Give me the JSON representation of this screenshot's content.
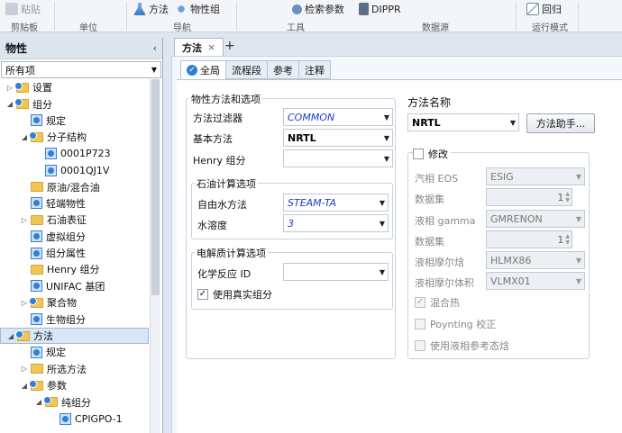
{
  "ribbon": {
    "paste": "粘贴",
    "clipboard": "剪贴板",
    "unit": "单位",
    "method": "方法",
    "property_set": "物性组",
    "nav": "导航",
    "retrieve_params": "检索参数",
    "tools": "工具",
    "dippr": "DIPPR",
    "datasource": "数据源",
    "revert": "回归",
    "run_mode": "运行模式"
  },
  "left": {
    "title": "物性",
    "collapse": "‹",
    "filter_value": "所有项",
    "tree": [
      {
        "label": "设置",
        "level": 0,
        "toggle": "▷",
        "icon": "folder-check"
      },
      {
        "label": "组分",
        "level": 0,
        "toggle": "◢",
        "icon": "folder-check"
      },
      {
        "label": "规定",
        "level": 1,
        "toggle": "",
        "icon": "form-check"
      },
      {
        "label": "分子结构",
        "level": 1,
        "toggle": "◢",
        "icon": "folder-check"
      },
      {
        "label": "0001P723",
        "level": 2,
        "toggle": "",
        "icon": "form-check"
      },
      {
        "label": "0001QJ1V",
        "level": 2,
        "toggle": "",
        "icon": "form-check"
      },
      {
        "label": "原油/混合油",
        "level": 1,
        "toggle": "",
        "icon": "folder"
      },
      {
        "label": "轻端物性",
        "level": 1,
        "toggle": "",
        "icon": "form-check"
      },
      {
        "label": "石油表征",
        "level": 1,
        "toggle": "▷",
        "icon": "folder"
      },
      {
        "label": "虚拟组分",
        "level": 1,
        "toggle": "",
        "icon": "form-check"
      },
      {
        "label": "组分属性",
        "level": 1,
        "toggle": "",
        "icon": "form-check"
      },
      {
        "label": "Henry 组分",
        "level": 1,
        "toggle": "",
        "icon": "folder"
      },
      {
        "label": "UNIFAC 基团",
        "level": 1,
        "toggle": "",
        "icon": "form-check"
      },
      {
        "label": "聚合物",
        "level": 1,
        "toggle": "▷",
        "icon": "folder-check"
      },
      {
        "label": "生物组分",
        "level": 1,
        "toggle": "",
        "icon": "form-check"
      },
      {
        "label": "方法",
        "level": 0,
        "toggle": "◢",
        "icon": "folder-check",
        "selected": true
      },
      {
        "label": "规定",
        "level": 1,
        "toggle": "",
        "icon": "form-check"
      },
      {
        "label": "所选方法",
        "level": 1,
        "toggle": "▷",
        "icon": "folder"
      },
      {
        "label": "参数",
        "level": 1,
        "toggle": "◢",
        "icon": "folder-check"
      },
      {
        "label": "纯组分",
        "level": 2,
        "toggle": "◢",
        "icon": "folder-check"
      },
      {
        "label": "CPIGPO-1",
        "level": 3,
        "toggle": "",
        "icon": "form-check"
      }
    ]
  },
  "doc_tab": {
    "label": "方法",
    "close": "×",
    "add": "+"
  },
  "form_tabs": [
    "全局",
    "流程段",
    "参考",
    "注释"
  ],
  "group_props": {
    "title": "物性方法和选项",
    "method_filter_label": "方法过滤器",
    "method_filter_value": "COMMON",
    "base_method_label": "基本方法",
    "base_method_value": "NRTL",
    "henry_label": "Henry 组分",
    "henry_value": ""
  },
  "group_petro": {
    "title": "石油计算选项",
    "free_water_label": "自由水方法",
    "free_water_value": "STEAM-TA",
    "water_sol_label": "水溶度",
    "water_sol_value": "3"
  },
  "group_elec": {
    "title": "电解质计算选项",
    "chem_id_label": "化学反应 ID",
    "chem_id_value": "",
    "use_true_label": "使用真实组分",
    "use_true_checked": "✓"
  },
  "method_name": {
    "label": "方法名称",
    "value": "NRTL",
    "helper_button": "方法助手..."
  },
  "modify": {
    "label": "修改",
    "vapor_eos_label": "汽相 EOS",
    "vapor_eos_value": "ESIG",
    "dataset1_label": "数据集",
    "dataset1_value": "1",
    "liq_gamma_label": "液相 gamma",
    "liq_gamma_value": "GMRENON",
    "dataset2_label": "数据集",
    "dataset2_value": "1",
    "liq_enth_label": "液相摩尔焓",
    "liq_enth_value": "HLMX86",
    "liq_vol_label": "液相摩尔体积",
    "liq_vol_value": "VLMX01",
    "heat_mix_label": "混合热",
    "heat_mix_checked": "✓",
    "poynting_label": "Poynting 校正",
    "ref_state_label": "使用液相参考态焓"
  }
}
